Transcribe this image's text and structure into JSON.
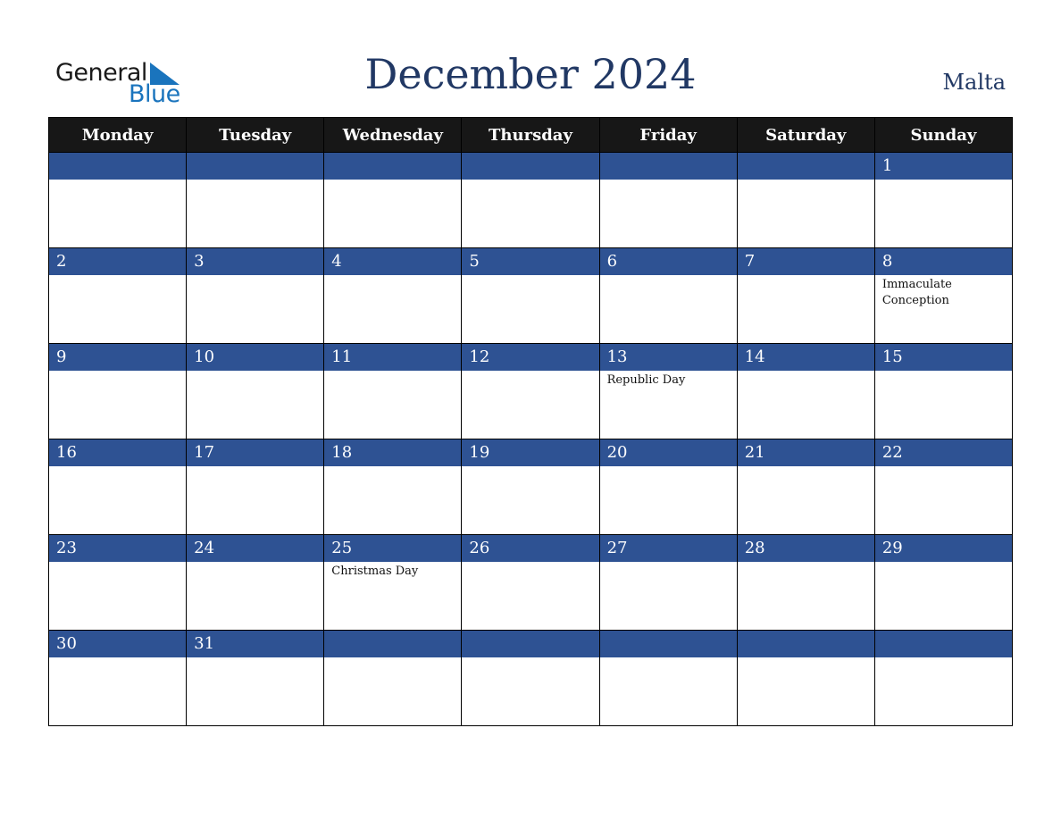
{
  "logo": {
    "line1": "General",
    "line2": "Blue"
  },
  "title": "December 2024",
  "country": "Malta",
  "colors": {
    "header_bg": "#171717",
    "day_bar": "#2e5293",
    "title": "#213864",
    "logo_blue": "#1a74bd"
  },
  "weekdays": [
    "Monday",
    "Tuesday",
    "Wednesday",
    "Thursday",
    "Friday",
    "Saturday",
    "Sunday"
  ],
  "weeks": [
    [
      {
        "day": "",
        "holiday": ""
      },
      {
        "day": "",
        "holiday": ""
      },
      {
        "day": "",
        "holiday": ""
      },
      {
        "day": "",
        "holiday": ""
      },
      {
        "day": "",
        "holiday": ""
      },
      {
        "day": "",
        "holiday": ""
      },
      {
        "day": "1",
        "holiday": ""
      }
    ],
    [
      {
        "day": "2",
        "holiday": ""
      },
      {
        "day": "3",
        "holiday": ""
      },
      {
        "day": "4",
        "holiday": ""
      },
      {
        "day": "5",
        "holiday": ""
      },
      {
        "day": "6",
        "holiday": ""
      },
      {
        "day": "7",
        "holiday": ""
      },
      {
        "day": "8",
        "holiday": "Immaculate Conception"
      }
    ],
    [
      {
        "day": "9",
        "holiday": ""
      },
      {
        "day": "10",
        "holiday": ""
      },
      {
        "day": "11",
        "holiday": ""
      },
      {
        "day": "12",
        "holiday": ""
      },
      {
        "day": "13",
        "holiday": "Republic Day"
      },
      {
        "day": "14",
        "holiday": ""
      },
      {
        "day": "15",
        "holiday": ""
      }
    ],
    [
      {
        "day": "16",
        "holiday": ""
      },
      {
        "day": "17",
        "holiday": ""
      },
      {
        "day": "18",
        "holiday": ""
      },
      {
        "day": "19",
        "holiday": ""
      },
      {
        "day": "20",
        "holiday": ""
      },
      {
        "day": "21",
        "holiday": ""
      },
      {
        "day": "22",
        "holiday": ""
      }
    ],
    [
      {
        "day": "23",
        "holiday": ""
      },
      {
        "day": "24",
        "holiday": ""
      },
      {
        "day": "25",
        "holiday": "Christmas Day"
      },
      {
        "day": "26",
        "holiday": ""
      },
      {
        "day": "27",
        "holiday": ""
      },
      {
        "day": "28",
        "holiday": ""
      },
      {
        "day": "29",
        "holiday": ""
      }
    ],
    [
      {
        "day": "30",
        "holiday": ""
      },
      {
        "day": "31",
        "holiday": ""
      },
      {
        "day": "",
        "holiday": ""
      },
      {
        "day": "",
        "holiday": ""
      },
      {
        "day": "",
        "holiday": ""
      },
      {
        "day": "",
        "holiday": ""
      },
      {
        "day": "",
        "holiday": ""
      }
    ]
  ]
}
